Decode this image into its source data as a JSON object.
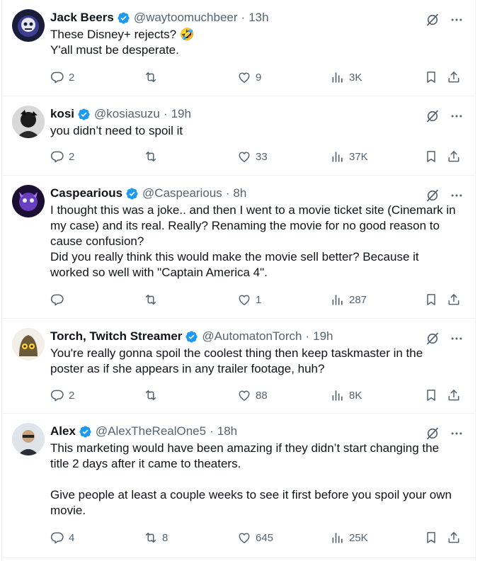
{
  "colors": {
    "verified": "#1d9bf0",
    "muted": "#536471",
    "text": "#0f1419",
    "border": "#eff3f4"
  },
  "tweets": [
    {
      "name": "Jack Beers",
      "handle": "@waytoomuchbeer",
      "time": "13h",
      "lines": [
        "These Disney+ rejects? 🤣",
        "Y'all must be desperate."
      ],
      "replies": "2",
      "retweets": "",
      "likes": "9",
      "views": "3K"
    },
    {
      "name": "kosi",
      "handle": "@kosiasuzu",
      "time": "19h",
      "lines": [
        "you didn’t need to spoil it"
      ],
      "replies": "2",
      "retweets": "",
      "likes": "33",
      "views": "37K"
    },
    {
      "name": "Caspearious",
      "handle": "@Caspearious",
      "time": "8h",
      "lines": [
        "I thought this was a joke.. and then I went to a movie ticket site (Cinemark in",
        "my case) and its real. Really? Renaming the movie for no good reason to",
        "cause confusion?",
        "Did you really think this would make the movie sell better? Because it",
        "worked so well with \"Captain America 4\"."
      ],
      "replies": "",
      "retweets": "",
      "likes": "1",
      "views": "287"
    },
    {
      "name": "Torch, Twitch Streamer",
      "handle": "@AutomatonTorch",
      "time": "19h",
      "lines": [
        "You're really gonna spoil the coolest thing then keep taskmaster in the",
        "poster as if she appears in any trailer footage, huh?"
      ],
      "replies": "2",
      "retweets": "",
      "likes": "88",
      "views": "8K"
    },
    {
      "name": "Alex",
      "handle": "@AlexTheRealOne5",
      "time": "18h",
      "lines": [
        "This marketing would have been amazing if they didn’t start changing the",
        "title 2 days after it came to theaters.",
        "",
        "Give people at least a couple weeks to see it first before you spoil your own",
        "movie."
      ],
      "replies": "4",
      "retweets": "8",
      "likes": "645",
      "views": "25K"
    }
  ]
}
